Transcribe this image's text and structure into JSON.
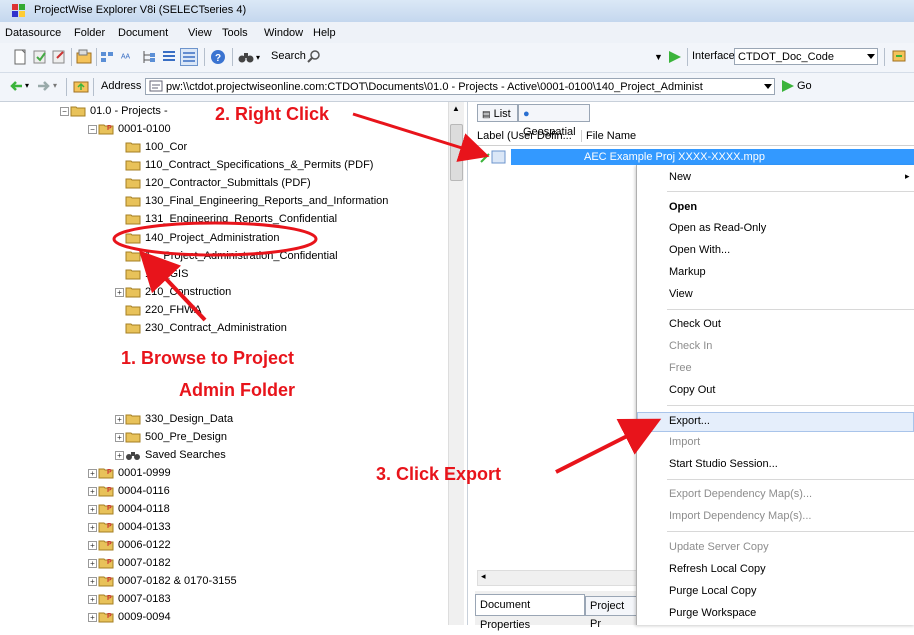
{
  "window": {
    "title": "ProjectWise Explorer V8i (SELECTseries 4)"
  },
  "menu": [
    "Datasource",
    "Folder",
    "Document",
    "View",
    "Tools",
    "Window",
    "Help"
  ],
  "toolbar": {
    "search_label": "Search",
    "interface_label": "Interface",
    "interface_value": "CTDOT_Doc_Code",
    "address_label": "Address",
    "address_value": "pw:\\\\ctdot.projectwiseonline.com:CTDOT\\Documents\\01.0 - Projects - Active\\0001-0100\\140_Project_Administ",
    "go_label": "Go"
  },
  "tree": {
    "root": "01.0 - Projects -",
    "project": "0001-0100",
    "children": [
      "100_Cor",
      "110_Contract_Specifications_&_Permits (PDF)",
      "120_Contractor_Submittals (PDF)",
      "130_Final_Engineering_Reports_and_Information",
      "131_Engineering_Reports_Confidential",
      "140_Project_Administration",
      "1__Project_Administration_Confidential",
      "150_GIS",
      "210_Construction",
      "220_FHWA",
      "230_Contract_Administration"
    ],
    "children_lower": [
      "330_Design_Data",
      "500_Pre_Design",
      "Saved Searches"
    ],
    "projects": [
      "0001-0999",
      "0004-0116",
      "0004-0118",
      "0004-0133",
      "0006-0122",
      "0007-0182",
      "0007-0182 & 0170-3155",
      "0007-0183",
      "0009-0094"
    ]
  },
  "right": {
    "tab_list": "List",
    "tab_geo": "Geospatial",
    "col_label": "Label (User Defin...",
    "col_filename": "File Name",
    "selected_file": "AEC Example Proj XXXX-XXXX.mpp",
    "bottom_tab1": "Document Properties",
    "bottom_tab2": "Project Pr"
  },
  "context_menu": {
    "new": "New",
    "open": "Open",
    "open_readonly": "Open as Read-Only",
    "open_with": "Open With...",
    "markup": "Markup",
    "view": "View",
    "check_out": "Check Out",
    "check_in": "Check In",
    "free": "Free",
    "copy_out": "Copy Out",
    "export": "Export...",
    "import": "Import",
    "studio": "Start Studio Session...",
    "export_dep": "Export Dependency Map(s)...",
    "import_dep": "Import Dependency Map(s)...",
    "update_server": "Update Server Copy",
    "refresh_local": "Refresh Local Copy",
    "purge_local": "Purge Local Copy",
    "purge_workspace": "Purge Workspace"
  },
  "annotations": {
    "step1_line1": "1. Browse to Project",
    "step1_line2": "Admin Folder",
    "step2": "2. Right Click",
    "step3": "3. Click Export"
  },
  "colors": {
    "annotation": "#e8141b",
    "selection": "#3399ff",
    "folder": "#e8c25a"
  }
}
